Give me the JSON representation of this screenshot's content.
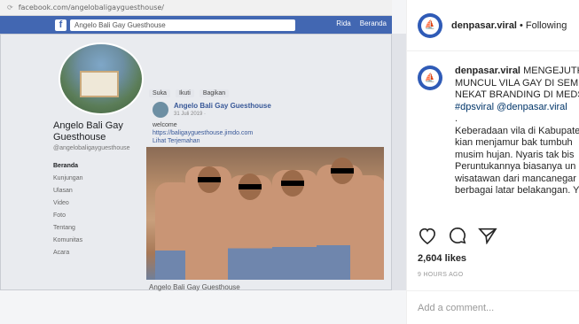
{
  "screenshot": {
    "url": "facebook.com/angelobaligayguesthouse/",
    "search_value": "Angelo Bali Gay Guesthouse",
    "top_right_nav": [
      "Rida",
      "Beranda"
    ],
    "page_name": "Angelo Bali Gay Guesthouse",
    "page_handle": "@angelobaligayguesthouse",
    "side_nav": [
      "Beranda",
      "Kunjungan",
      "Ulasan",
      "Video",
      "Foto",
      "Tentang",
      "Komunitas",
      "Acara"
    ],
    "post_tabs": [
      "Suka",
      "Ikuti",
      "Bagikan"
    ],
    "post_author": "Angelo Bali Gay Guesthouse",
    "post_date": "31 Juli 2019 · ",
    "post_lines": [
      "welcome",
      "https://baligayguesthouse.jimdo.com",
      "Lihat Terjemahan"
    ],
    "caption_below": "Angelo Bali Gay Guesthouse"
  },
  "instagram": {
    "username": "denpasar.viral",
    "follow_status": "Following",
    "separator": "•",
    "caption_lines": [
      "MENGEJUTKAN",
      "MUNCUL VILA GAY DI SEMI",
      "NEKAT BRANDING DI MEDS",
      "#dpsviral @denpasar.viral",
      ".",
      "Keberadaan vila di Kabupate",
      "kian menjamur bak tumbuh",
      "musim hujan. Nyaris tak bis",
      "Peruntukannya biasanya un",
      "wisatawan dari mancanegar",
      "berbagai latar belakangan. Y"
    ],
    "likes": "2,604 likes",
    "timestamp": "9 HOURS AGO",
    "comment_placeholder": "Add a comment..."
  },
  "colors": {
    "facebook_blue": "#4267b2",
    "instagram_text": "#262626",
    "hashtag": "#003569"
  },
  "icons": [
    "heart-icon",
    "comment-icon",
    "share-icon",
    "boat-logo-icon"
  ]
}
